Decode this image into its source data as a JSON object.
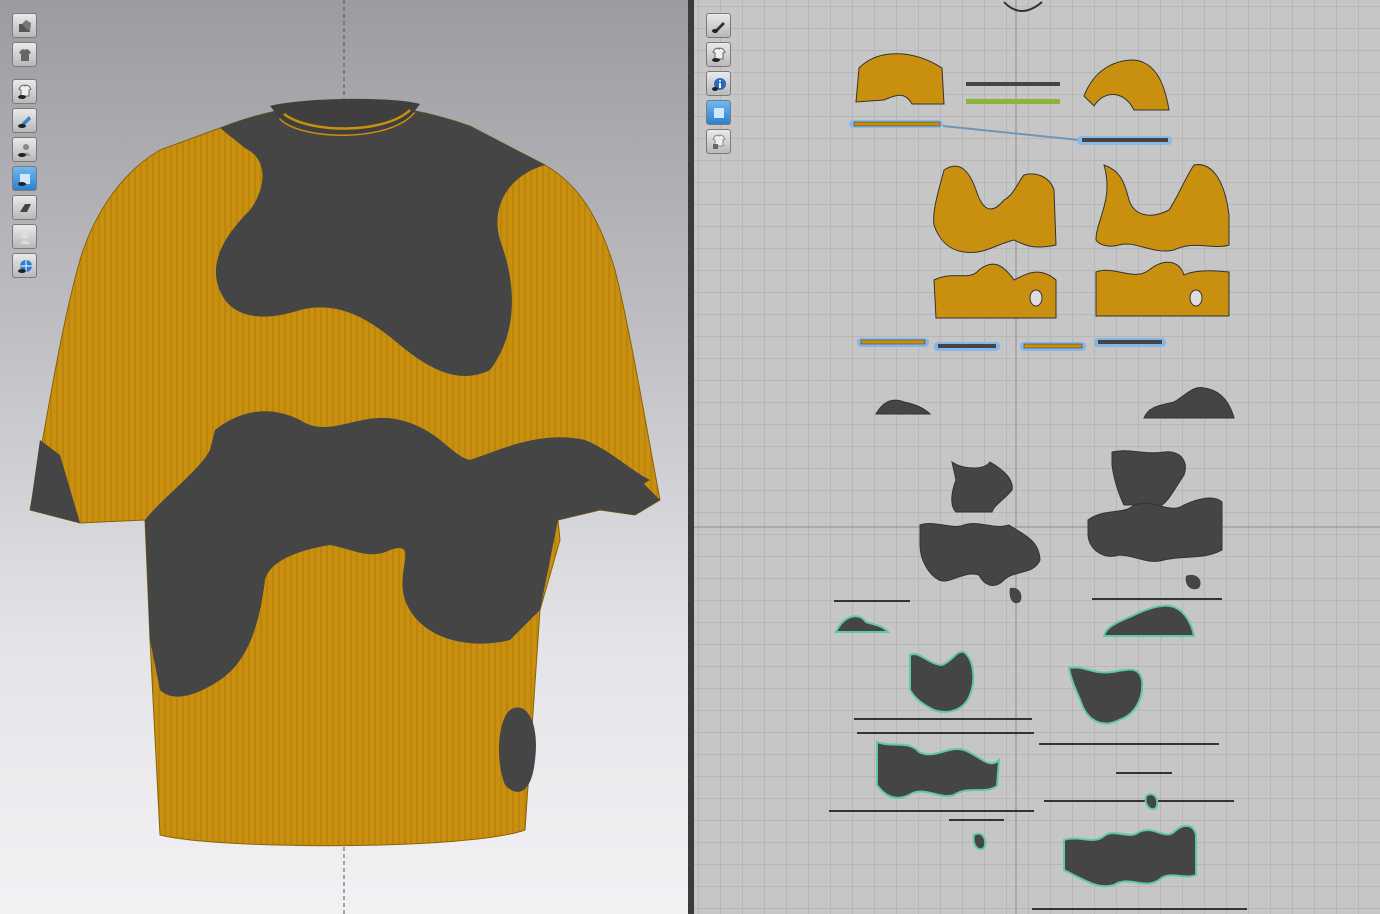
{
  "viewport3d": {
    "toolbar": [
      {
        "icon": "avatar-display-icon"
      },
      {
        "icon": "garment-display-icon"
      },
      {
        "icon": "show-garment-icon"
      },
      {
        "icon": "show-pins-icon"
      },
      {
        "icon": "show-avatar-icon"
      },
      {
        "icon": "texture-view-icon"
      },
      {
        "icon": "thickness-view-icon"
      },
      {
        "icon": "avatar-silhouette-icon"
      },
      {
        "icon": "show-grid-icon"
      }
    ]
  },
  "viewport2d": {
    "toolbar": [
      {
        "icon": "edit-pattern-icon"
      },
      {
        "icon": "show-pattern-icon"
      },
      {
        "icon": "pattern-info-icon"
      },
      {
        "icon": "pattern-texture-icon"
      },
      {
        "icon": "lock-pattern-icon"
      }
    ]
  },
  "colors": {
    "fabric_mustard": "#c8900e",
    "fabric_charcoal": "#454545",
    "seam_blue": "#86b6e6",
    "seam_green": "#5fc9a2",
    "grid_bg": "#c6c6c6"
  }
}
